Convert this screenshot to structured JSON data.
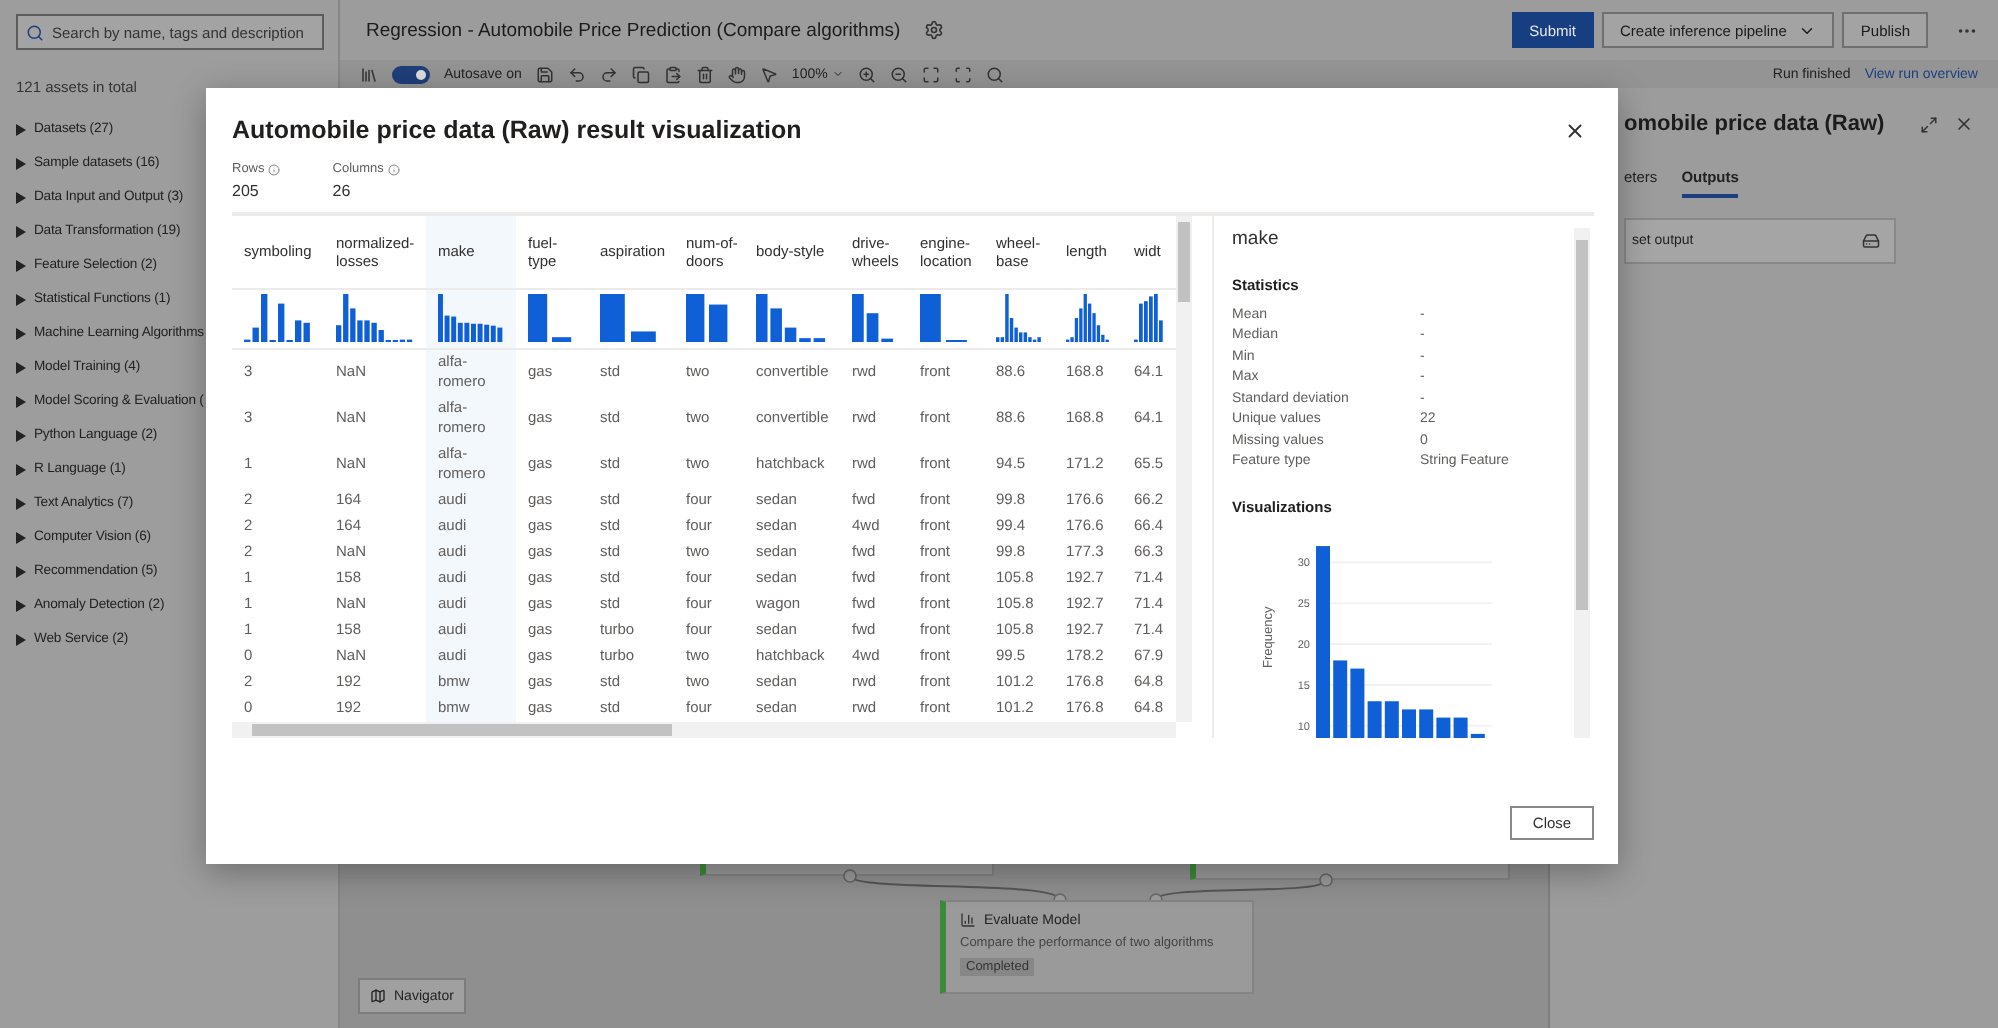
{
  "sidebar": {
    "search": {
      "placeholder": "Search by name, tags and description"
    },
    "total": "121 assets in total",
    "items": [
      {
        "label": "Datasets (27)",
        "expanded": false
      },
      {
        "label": "Sample datasets (16)",
        "expanded": false
      },
      {
        "label": "Data Input and Output (3)",
        "expanded": false
      },
      {
        "label": "Data Transformation (19)",
        "expanded": false
      },
      {
        "label": "Feature Selection (2)",
        "expanded": false
      },
      {
        "label": "Statistical Functions (1)",
        "expanded": false
      },
      {
        "label": "Machine Learning Algorithms",
        "expanded": false
      },
      {
        "label": "Model Training (4)",
        "expanded": false
      },
      {
        "label": "Model Scoring & Evaluation (",
        "expanded": false
      },
      {
        "label": "Python Language (2)",
        "expanded": false
      },
      {
        "label": "R Language (1)",
        "expanded": false
      },
      {
        "label": "Text Analytics (7)",
        "expanded": false
      },
      {
        "label": "Computer Vision (6)",
        "expanded": false
      },
      {
        "label": "Recommendation (5)",
        "expanded": false
      },
      {
        "label": "Anomaly Detection (2)",
        "expanded": false
      },
      {
        "label": "Web Service (2)",
        "expanded": false
      }
    ]
  },
  "header": {
    "title": "Regression - Automobile Price Prediction (Compare algorithms)",
    "buttons": [
      {
        "label": "Submit",
        "kind": "primary"
      },
      {
        "label": "Create inference pipeline",
        "kind": "dropdown"
      },
      {
        "label": "Publish",
        "kind": "default"
      }
    ]
  },
  "toolbar": {
    "autosave": {
      "label": "Autosave on",
      "on": true
    },
    "zoom": "100%",
    "status": "Run finished",
    "link": "View run overview"
  },
  "canvas": {
    "node": {
      "title": "Evaluate Model",
      "description": "Compare the performance of two algorithms",
      "status": "Completed"
    },
    "navigator": "Navigator"
  },
  "details_panel": {
    "title": "omobile price data (Raw)",
    "tabs": [
      {
        "label": "eters",
        "selected": false
      },
      {
        "label": "Outputs",
        "selected": true
      }
    ],
    "output": "set output"
  },
  "modal": {
    "title": "Automobile price data (Raw) result visualization",
    "stats": [
      {
        "label": "Rows",
        "value": "205"
      },
      {
        "label": "Columns",
        "value": "26"
      }
    ],
    "table": {
      "columns": [
        {
          "label": "symboling",
          "selected": false
        },
        {
          "label": "normalized-losses",
          "selected": false
        },
        {
          "label": "make",
          "selected": true
        },
        {
          "label": "fuel-type",
          "selected": false
        },
        {
          "label": "aspiration",
          "selected": false
        },
        {
          "label": "num-of-doors",
          "selected": false
        },
        {
          "label": "body-style",
          "selected": false
        },
        {
          "label": "drive-wheels",
          "selected": false
        },
        {
          "label": "engine-location",
          "selected": false
        },
        {
          "label": "wheel-base",
          "selected": false
        },
        {
          "label": "length",
          "selected": false
        },
        {
          "label": "widt",
          "selected": false
        }
      ],
      "rows": [
        [
          "3",
          "NaN",
          "alfa-romero",
          "gas",
          "std",
          "two",
          "convertible",
          "rwd",
          "front",
          "88.6",
          "168.8",
          "64.1"
        ],
        [
          "3",
          "NaN",
          "alfa-romero",
          "gas",
          "std",
          "two",
          "convertible",
          "rwd",
          "front",
          "88.6",
          "168.8",
          "64.1"
        ],
        [
          "1",
          "NaN",
          "alfa-romero",
          "gas",
          "std",
          "two",
          "hatchback",
          "rwd",
          "front",
          "94.5",
          "171.2",
          "65.5"
        ],
        [
          "2",
          "164",
          "audi",
          "gas",
          "std",
          "four",
          "sedan",
          "fwd",
          "front",
          "99.8",
          "176.6",
          "66.2"
        ],
        [
          "2",
          "164",
          "audi",
          "gas",
          "std",
          "four",
          "sedan",
          "4wd",
          "front",
          "99.4",
          "176.6",
          "66.4"
        ],
        [
          "2",
          "NaN",
          "audi",
          "gas",
          "std",
          "two",
          "sedan",
          "fwd",
          "front",
          "99.8",
          "177.3",
          "66.3"
        ],
        [
          "1",
          "158",
          "audi",
          "gas",
          "std",
          "four",
          "sedan",
          "fwd",
          "front",
          "105.8",
          "192.7",
          "71.4"
        ],
        [
          "1",
          "NaN",
          "audi",
          "gas",
          "std",
          "four",
          "wagon",
          "fwd",
          "front",
          "105.8",
          "192.7",
          "71.4"
        ],
        [
          "1",
          "158",
          "audi",
          "gas",
          "turbo",
          "four",
          "sedan",
          "fwd",
          "front",
          "105.8",
          "192.7",
          "71.4"
        ],
        [
          "0",
          "NaN",
          "audi",
          "gas",
          "turbo",
          "two",
          "hatchback",
          "4wd",
          "front",
          "99.5",
          "178.2",
          "67.9"
        ],
        [
          "2",
          "192",
          "bmw",
          "gas",
          "std",
          "two",
          "sedan",
          "rwd",
          "front",
          "101.2",
          "176.8",
          "64.8"
        ],
        [
          "0",
          "192",
          "bmw",
          "gas",
          "std",
          "four",
          "sedan",
          "rwd",
          "front",
          "101.2",
          "176.8",
          "64.8"
        ]
      ]
    },
    "column_details": {
      "name": "make",
      "statistics_heading": "Statistics",
      "statistics": [
        {
          "label": "Mean",
          "value": "-"
        },
        {
          "label": "Median",
          "value": "-"
        },
        {
          "label": "Min",
          "value": "-"
        },
        {
          "label": "Max",
          "value": "-"
        },
        {
          "label": "Standard deviation",
          "value": "-"
        },
        {
          "label": "Unique values",
          "value": "22"
        },
        {
          "label": "Missing values",
          "value": "0"
        },
        {
          "label": "Feature type",
          "value": "String Feature"
        }
      ],
      "visualizations_heading": "Visualizations",
      "chart_data": {
        "type": "bar",
        "ylabel": "Frequency",
        "values": [
          32,
          18,
          17,
          13,
          13,
          12,
          12,
          11,
          11,
          9
        ],
        "ylim": [
          8.5,
          32.5
        ],
        "yticks": [
          10,
          15,
          20,
          25,
          30
        ],
        "grid": true
      }
    },
    "close_button": "Close"
  }
}
